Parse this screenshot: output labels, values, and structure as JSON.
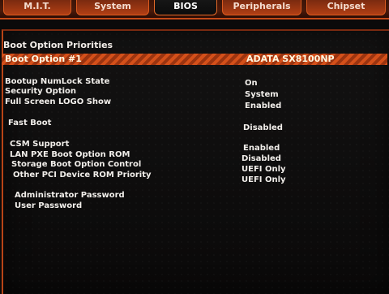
{
  "tabs": [
    {
      "label": "M.I.T."
    },
    {
      "label": "System"
    },
    {
      "label": "BIOS"
    },
    {
      "label": "Peripherals"
    },
    {
      "label": "Chipset"
    }
  ],
  "active_tab": "BIOS",
  "section_title": "Boot Option Priorities",
  "boot_option_1": {
    "label": "Boot Option #1",
    "value": "ADATA SX8100NP"
  },
  "options": [
    {
      "label": "Bootup NumLock State",
      "value": "On"
    },
    {
      "label": "Security Option",
      "value": "System"
    },
    {
      "label": "Full Screen LOGO Show",
      "value": "Enabled"
    },
    {
      "label": "Fast Boot",
      "value": "Disabled"
    },
    {
      "label": "CSM Support",
      "value": "Enabled"
    },
    {
      "label": "LAN PXE Boot Option ROM",
      "value": "Disabled"
    },
    {
      "label": "Storage Boot Option Control",
      "value": "UEFI Only"
    },
    {
      "label": "Other PCI Device ROM Priority",
      "value": "UEFI Only"
    },
    {
      "label": "Administrator Password",
      "value": ""
    },
    {
      "label": "User Password",
      "value": ""
    }
  ],
  "colors": {
    "accent": "#d4501a",
    "accent_dark": "#9b3410",
    "background": "#0b0a0a"
  }
}
